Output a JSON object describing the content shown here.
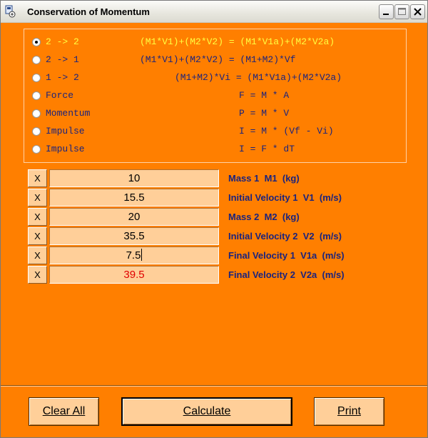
{
  "window": {
    "title": "Conservation of Momentum",
    "icon": "calculator-icon"
  },
  "formulas": [
    {
      "label": "2 -> 2",
      "equation": "(M1*V1)+(M2*V2) = (M1*V1a)+(M2*V2a)",
      "selected": true
    },
    {
      "label": "2 -> 1",
      "equation": "(M1*V1)+(M2*V2) = (M1+M2)*Vf",
      "selected": false
    },
    {
      "label": "1 -> 2",
      "equation": "(M1+M2)*Vi = (M1*V1a)+(M2*V2a)",
      "selected": false
    },
    {
      "label": "Force",
      "equation": "F = M * A",
      "selected": false
    },
    {
      "label": "Momentum",
      "equation": "P = M * V",
      "selected": false
    },
    {
      "label": "Impulse",
      "equation": "I = M * (Vf - Vi)",
      "selected": false
    },
    {
      "label": "Impulse",
      "equation": "I = F * dT",
      "selected": false
    }
  ],
  "inputs": [
    {
      "clear_label": "X",
      "value": "10",
      "label": "Mass 1  M1  (kg)"
    },
    {
      "clear_label": "X",
      "value": "15.5",
      "label": "Initial Velocity 1  V1  (m/s)"
    },
    {
      "clear_label": "X",
      "value": "20",
      "label": "Mass 2  M2  (kg)"
    },
    {
      "clear_label": "X",
      "value": "35.5",
      "label": "Initial Velocity 2  V2  (m/s)"
    },
    {
      "clear_label": "X",
      "value": "7.5",
      "label": "Final Velocity 1  V1a  (m/s)"
    },
    {
      "clear_label": "X",
      "value": "39.5",
      "label": "Final Velocity 2  V2a  (m/s)"
    }
  ],
  "buttons": {
    "clear_all": "Clear All",
    "calculate": "Calculate",
    "print": "Print"
  },
  "colors": {
    "background": "#ff7f00",
    "selected_formula": "#ffff40",
    "formula_text": "#1a237e",
    "result_value": "#e00000",
    "field_bg": "#ffcf99"
  }
}
